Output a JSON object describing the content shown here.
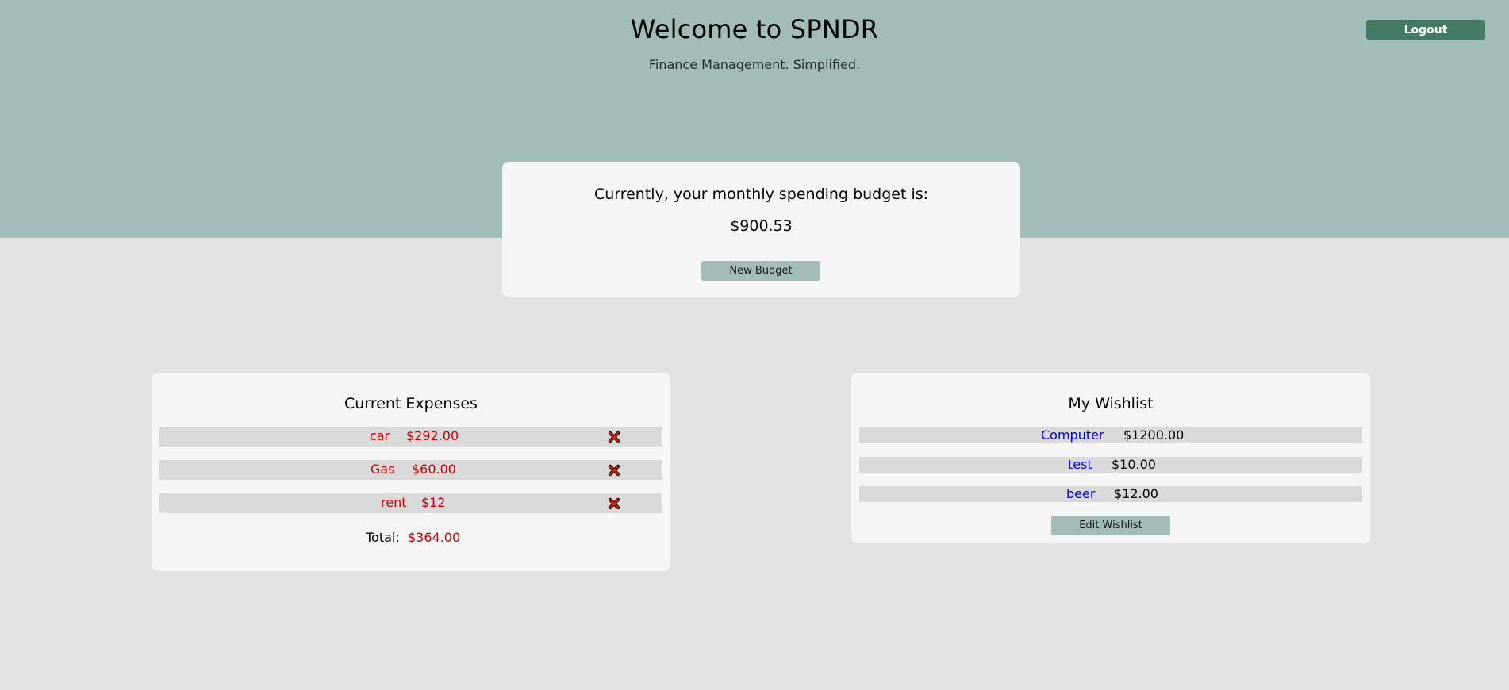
{
  "header": {
    "title": "Welcome to SPNDR",
    "tagline": "Finance Management. Simplified.",
    "logout_label": "Logout"
  },
  "budget": {
    "label": "Currently, your monthly spending budget is:",
    "amount": "$900.53",
    "new_budget_label": "New Budget"
  },
  "expenses": {
    "title": "Current Expenses",
    "items": [
      {
        "name": "car",
        "amount": "$292.00"
      },
      {
        "name": "Gas",
        "amount": "$60.00"
      },
      {
        "name": "rent",
        "amount": "$12"
      }
    ],
    "total_label": "Total:",
    "total_value": "$364.00"
  },
  "wishlist": {
    "title": "My Wishlist",
    "items": [
      {
        "name": "Computer",
        "price": "$1200.00"
      },
      {
        "name": "test",
        "price": "$10.00"
      },
      {
        "name": "beer",
        "price": "$12.00"
      }
    ],
    "edit_label": "Edit Wishlist"
  },
  "colors": {
    "header_bg": "#a2bdb9",
    "page_bg": "#e2e2e2",
    "card_bg": "#f5f5f5",
    "logout_bg": "#447a63",
    "expense_text": "#cc0000",
    "wish_link": "#0000dd",
    "delete_icon": "#cc2200"
  },
  "icons": {
    "delete": "close-x-icon"
  }
}
